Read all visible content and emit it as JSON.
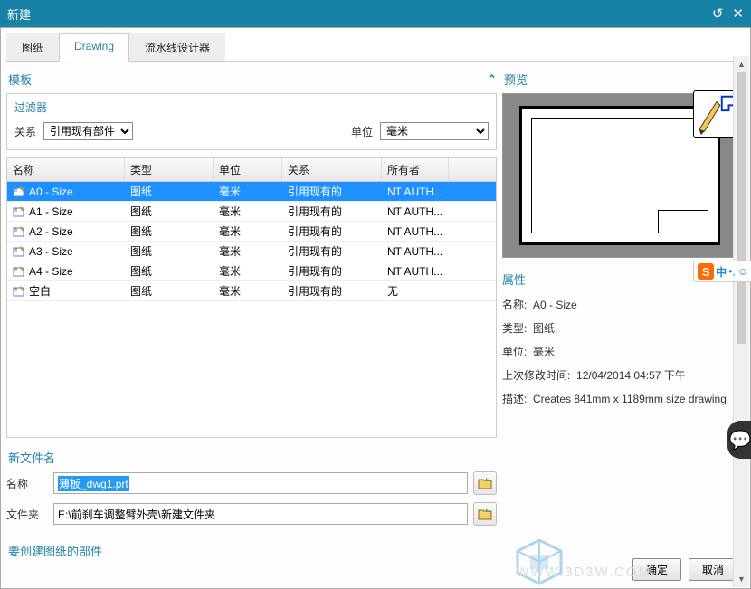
{
  "title": "新建",
  "tabs": {
    "t1": "图纸",
    "t2": "Drawing",
    "t3": "流水线设计器"
  },
  "templates_label": "模板",
  "preview_label": "预览",
  "filter": {
    "title": "过滤器",
    "relation_label": "关系",
    "relation_value": "引用现有部件",
    "unit_label": "单位",
    "unit_value": "毫米"
  },
  "columns": {
    "name": "名称",
    "type": "类型",
    "unit": "单位",
    "relation": "关系",
    "owner": "所有者"
  },
  "rows": [
    {
      "name": "A0 - Size",
      "type": "图纸",
      "unit": "毫米",
      "relation": "引用现有的",
      "owner": "NT AUTH..."
    },
    {
      "name": "A1 - Size",
      "type": "图纸",
      "unit": "毫米",
      "relation": "引用现有的",
      "owner": "NT AUTH..."
    },
    {
      "name": "A2 - Size",
      "type": "图纸",
      "unit": "毫米",
      "relation": "引用现有的",
      "owner": "NT AUTH..."
    },
    {
      "name": "A3 - Size",
      "type": "图纸",
      "unit": "毫米",
      "relation": "引用现有的",
      "owner": "NT AUTH..."
    },
    {
      "name": "A4 - Size",
      "type": "图纸",
      "unit": "毫米",
      "relation": "引用现有的",
      "owner": "NT AUTH..."
    },
    {
      "name": "空白",
      "type": "图纸",
      "unit": "毫米",
      "relation": "引用现有的",
      "owner": "无"
    }
  ],
  "properties": {
    "title": "属性",
    "name_label": "名称:",
    "name_value": "A0 - Size",
    "type_label": "类型:",
    "type_value": "图纸",
    "unit_label": "单位:",
    "unit_value": "毫米",
    "modified_label": "上次修改时间:",
    "modified_value": "12/04/2014 04:57 下午",
    "desc_label": "描述:",
    "desc_value": "Creates 841mm x 1189mm size drawing"
  },
  "newfile": {
    "title": "新文件名",
    "name_label": "名称",
    "name_value": "薄板_dwg1.prt",
    "folder_label": "文件夹",
    "folder_value": "E:\\前刹车调整臂外壳\\新建文件夹"
  },
  "parts_label": "要创建图纸的部件",
  "buttons": {
    "ok": "确定",
    "cancel": "取消"
  },
  "ime": {
    "s": "S",
    "zh": "中"
  },
  "watermark": "WWW.3D3W.COM"
}
